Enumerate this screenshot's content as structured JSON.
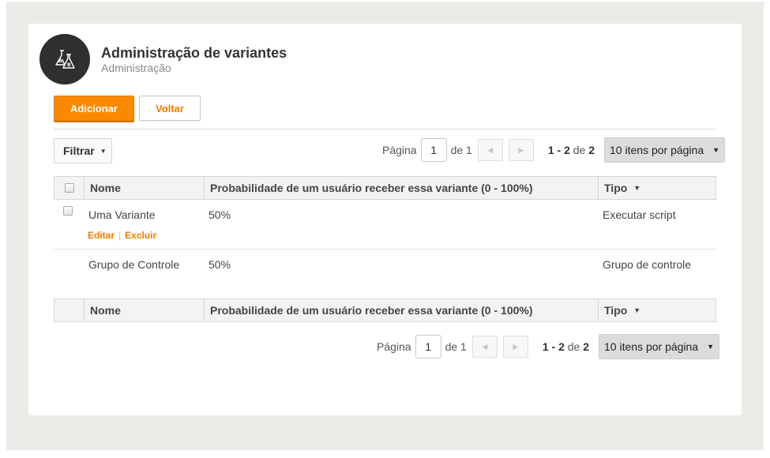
{
  "header": {
    "title": "Administração de variantes",
    "subtitle": "Administração",
    "logo_icon": "ab-test-flask-icon"
  },
  "toolbar": {
    "add_label": "Adicionar",
    "back_label": "Voltar"
  },
  "filter": {
    "label": "Filtrar"
  },
  "pagination": {
    "page_label": "Página",
    "current_page": "1",
    "of_label": "de 1",
    "range_text": "1 - 2",
    "range_of": "de",
    "total": "2",
    "per_page": "10 itens por página"
  },
  "table": {
    "columns": {
      "name": "Nome",
      "probability": "Probabilidade de um usuário receber essa variante (0 - 100%)",
      "type": "Tipo"
    },
    "rows": [
      {
        "name": "Uma Variante",
        "probability": "50%",
        "type": "Executar script",
        "edit_label": "Editar",
        "delete_label": "Excluir"
      },
      {
        "name": "Grupo de Controle",
        "probability": "50%",
        "type": "Grupo de controle"
      }
    ]
  },
  "colors": {
    "accent": "#f98a00",
    "logo_bg": "#2f2f2f"
  }
}
